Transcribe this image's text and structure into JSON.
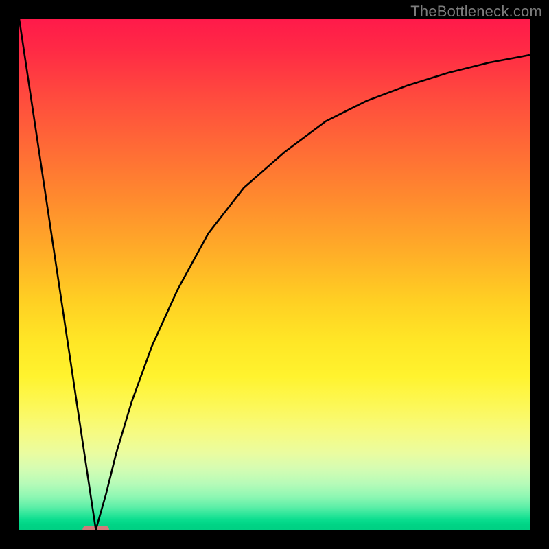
{
  "watermark": "TheBottleneck.com",
  "chart_data": {
    "type": "line",
    "title": "",
    "xlabel": "",
    "ylabel": "",
    "xlim": [
      0,
      100
    ],
    "ylim": [
      0,
      100
    ],
    "grid": false,
    "series": [
      {
        "name": "left-line",
        "x": [
          0,
          15
        ],
        "y": [
          100,
          0
        ]
      },
      {
        "name": "right-curve",
        "x": [
          15,
          17,
          19,
          22,
          26,
          31,
          37,
          44,
          52,
          60,
          68,
          76,
          84,
          92,
          100
        ],
        "y": [
          0,
          7,
          15,
          25,
          36,
          47,
          58,
          67,
          74,
          80,
          84,
          87,
          89.5,
          91.5,
          93
        ]
      }
    ],
    "marker": {
      "name": "min-pill",
      "x_center": 15,
      "y_center": 0,
      "width_pct": 5.2,
      "height_pct": 1.6,
      "color": "#d17a7a"
    }
  }
}
